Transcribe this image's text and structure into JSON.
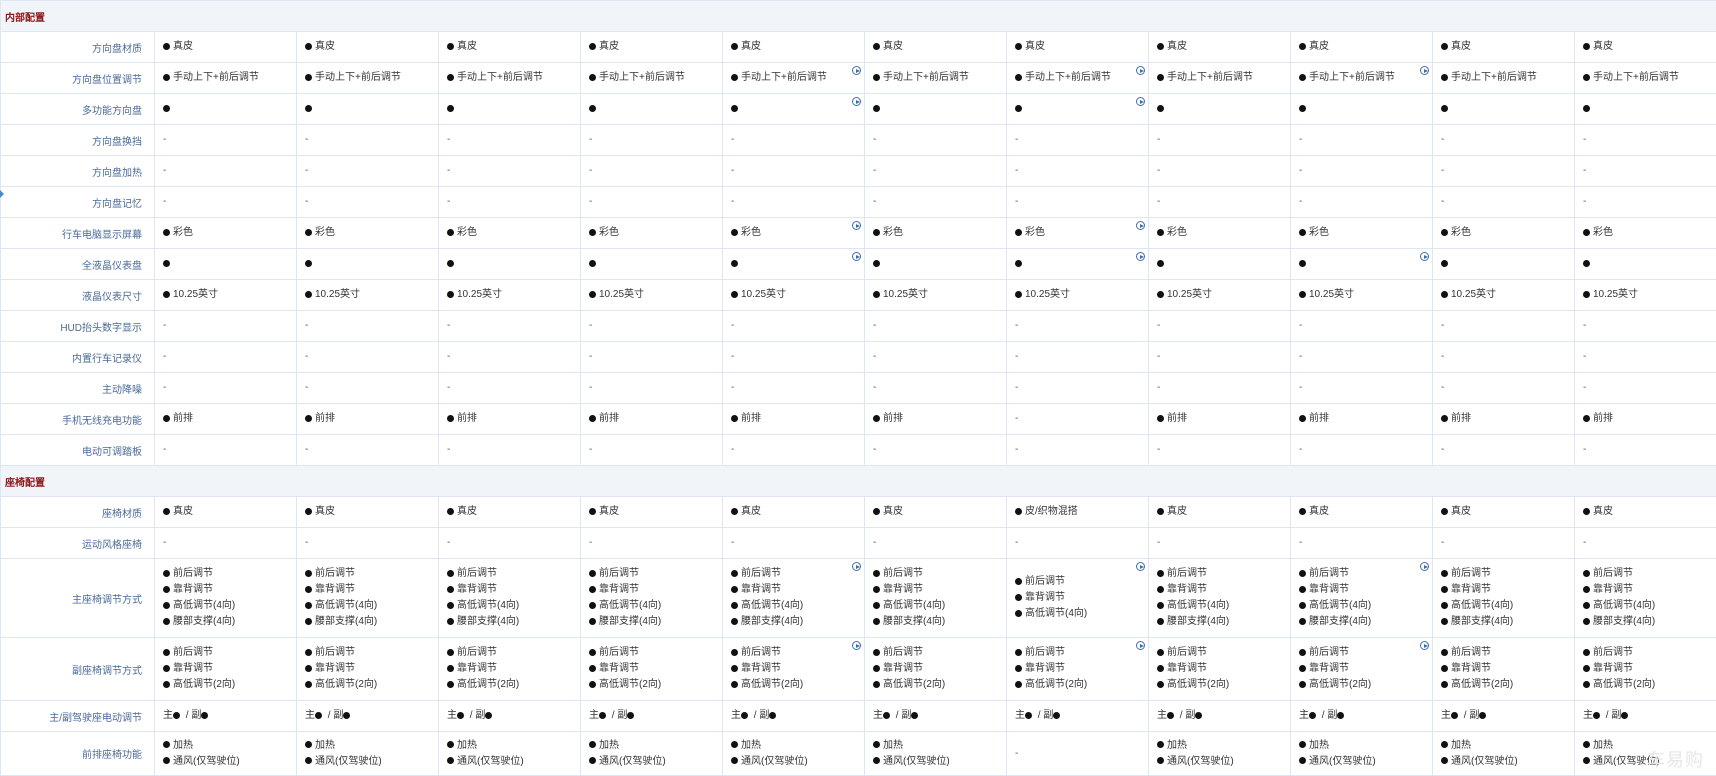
{
  "sections": [
    {
      "title": "内部配置",
      "rows": [
        {
          "label": "方向盘材质",
          "h": 31,
          "cells": [
            [
              "●真皮"
            ],
            [
              "●真皮"
            ],
            [
              "●真皮"
            ],
            [
              "●真皮"
            ],
            [
              "●真皮"
            ],
            [
              "●真皮"
            ],
            [
              "●真皮"
            ],
            [
              "●真皮"
            ],
            [
              "●真皮"
            ],
            [
              "●真皮"
            ],
            [
              "●真皮"
            ]
          ]
        },
        {
          "label": "方向盘位置调节",
          "h": 31,
          "play": [
            4,
            6,
            8
          ],
          "cells": [
            [
              "●手动上下+前后调节"
            ],
            [
              "●手动上下+前后调节"
            ],
            [
              "●手动上下+前后调节"
            ],
            [
              "●手动上下+前后调节"
            ],
            [
              "●手动上下+前后调节"
            ],
            [
              "●手动上下+前后调节"
            ],
            [
              "●手动上下+前后调节"
            ],
            [
              "●手动上下+前后调节"
            ],
            [
              "●手动上下+前后调节"
            ],
            [
              "●手动上下+前后调节"
            ],
            [
              "●手动上下+前后调节"
            ]
          ]
        },
        {
          "label": "多功能方向盘",
          "h": 31,
          "play": [
            4,
            6
          ],
          "cells": [
            [
              "●"
            ],
            [
              "●"
            ],
            [
              "●"
            ],
            [
              "●"
            ],
            [
              "●"
            ],
            [
              "●"
            ],
            [
              "●"
            ],
            [
              "●"
            ],
            [
              "●"
            ],
            [
              "●"
            ],
            [
              "●"
            ]
          ]
        },
        {
          "label": "方向盘换挡",
          "h": 31,
          "cells": [
            [
              "-"
            ],
            [
              "-"
            ],
            [
              "-"
            ],
            [
              "-"
            ],
            [
              "-"
            ],
            [
              "-"
            ],
            [
              "-"
            ],
            [
              "-"
            ],
            [
              "-"
            ],
            [
              "-"
            ],
            [
              "-"
            ]
          ]
        },
        {
          "label": "方向盘加热",
          "h": 31,
          "cells": [
            [
              "-"
            ],
            [
              "-"
            ],
            [
              "-"
            ],
            [
              "-"
            ],
            [
              "-"
            ],
            [
              "-"
            ],
            [
              "-"
            ],
            [
              "-"
            ],
            [
              "-"
            ],
            [
              "-"
            ],
            [
              "-"
            ]
          ]
        },
        {
          "label": "方向盘记忆",
          "h": 31,
          "cells": [
            [
              "-"
            ],
            [
              "-"
            ],
            [
              "-"
            ],
            [
              "-"
            ],
            [
              "-"
            ],
            [
              "-"
            ],
            [
              "-"
            ],
            [
              "-"
            ],
            [
              "-"
            ],
            [
              "-"
            ],
            [
              "-"
            ]
          ]
        },
        {
          "label": "行车电脑显示屏幕",
          "h": 31,
          "play": [
            4,
            6
          ],
          "cells": [
            [
              "●彩色"
            ],
            [
              "●彩色"
            ],
            [
              "●彩色"
            ],
            [
              "●彩色"
            ],
            [
              "●彩色"
            ],
            [
              "●彩色"
            ],
            [
              "●彩色"
            ],
            [
              "●彩色"
            ],
            [
              "●彩色"
            ],
            [
              "●彩色"
            ],
            [
              "●彩色"
            ]
          ]
        },
        {
          "label": "全液晶仪表盘",
          "h": 31,
          "play": [
            4,
            6,
            8
          ],
          "cells": [
            [
              "●"
            ],
            [
              "●"
            ],
            [
              "●"
            ],
            [
              "●"
            ],
            [
              "●"
            ],
            [
              "●"
            ],
            [
              "●"
            ],
            [
              "●"
            ],
            [
              "●"
            ],
            [
              "●"
            ],
            [
              "●"
            ]
          ]
        },
        {
          "label": "液晶仪表尺寸",
          "h": 31,
          "cells": [
            [
              "●10.25英寸"
            ],
            [
              "●10.25英寸"
            ],
            [
              "●10.25英寸"
            ],
            [
              "●10.25英寸"
            ],
            [
              "●10.25英寸"
            ],
            [
              "●10.25英寸"
            ],
            [
              "●10.25英寸"
            ],
            [
              "●10.25英寸"
            ],
            [
              "●10.25英寸"
            ],
            [
              "●10.25英寸"
            ],
            [
              "●10.25英寸"
            ]
          ]
        },
        {
          "label": "HUD抬头数字显示",
          "h": 31,
          "cells": [
            [
              "-"
            ],
            [
              "-"
            ],
            [
              "-"
            ],
            [
              "-"
            ],
            [
              "-"
            ],
            [
              "-"
            ],
            [
              "-"
            ],
            [
              "-"
            ],
            [
              "-"
            ],
            [
              "-"
            ],
            [
              "-"
            ]
          ]
        },
        {
          "label": "内置行车记录仪",
          "h": 31,
          "cells": [
            [
              "-"
            ],
            [
              "-"
            ],
            [
              "-"
            ],
            [
              "-"
            ],
            [
              "-"
            ],
            [
              "-"
            ],
            [
              "-"
            ],
            [
              "-"
            ],
            [
              "-"
            ],
            [
              "-"
            ],
            [
              "-"
            ]
          ]
        },
        {
          "label": "主动降噪",
          "h": 31,
          "cells": [
            [
              "-"
            ],
            [
              "-"
            ],
            [
              "-"
            ],
            [
              "-"
            ],
            [
              "-"
            ],
            [
              "-"
            ],
            [
              "-"
            ],
            [
              "-"
            ],
            [
              "-"
            ],
            [
              "-"
            ],
            [
              "-"
            ]
          ]
        },
        {
          "label": "手机无线充电功能",
          "h": 31,
          "cells": [
            [
              "●前排"
            ],
            [
              "●前排"
            ],
            [
              "●前排"
            ],
            [
              "●前排"
            ],
            [
              "●前排"
            ],
            [
              "●前排"
            ],
            [
              "-"
            ],
            [
              "●前排"
            ],
            [
              "●前排"
            ],
            [
              "●前排"
            ],
            [
              "●前排"
            ]
          ]
        },
        {
          "label": "电动可调踏板",
          "h": 31,
          "cells": [
            [
              "-"
            ],
            [
              "-"
            ],
            [
              "-"
            ],
            [
              "-"
            ],
            [
              "-"
            ],
            [
              "-"
            ],
            [
              "-"
            ],
            [
              "-"
            ],
            [
              "-"
            ],
            [
              "-"
            ],
            [
              "-"
            ]
          ]
        }
      ]
    },
    {
      "title": "座椅配置",
      "rows": [
        {
          "label": "座椅材质",
          "h": 31,
          "cells": [
            [
              "●真皮"
            ],
            [
              "●真皮"
            ],
            [
              "●真皮"
            ],
            [
              "●真皮"
            ],
            [
              "●真皮"
            ],
            [
              "●真皮"
            ],
            [
              "●皮/织物混搭"
            ],
            [
              "●真皮"
            ],
            [
              "●真皮"
            ],
            [
              "●真皮"
            ],
            [
              "●真皮"
            ]
          ]
        },
        {
          "label": "运动风格座椅",
          "h": 31,
          "cells": [
            [
              "-"
            ],
            [
              "-"
            ],
            [
              "-"
            ],
            [
              "-"
            ],
            [
              "-"
            ],
            [
              "-"
            ],
            [
              "-"
            ],
            [
              "-"
            ],
            [
              "-"
            ],
            [
              "-"
            ],
            [
              "-"
            ]
          ]
        },
        {
          "label": "主座椅调节方式",
          "h": 79,
          "play": [
            4,
            6,
            8
          ],
          "cells": [
            [
              "●前后调节",
              "●靠背调节",
              "●高低调节(4向)",
              "●腰部支撑(4向)"
            ],
            [
              "●前后调节",
              "●靠背调节",
              "●高低调节(4向)",
              "●腰部支撑(4向)"
            ],
            [
              "●前后调节",
              "●靠背调节",
              "●高低调节(4向)",
              "●腰部支撑(4向)"
            ],
            [
              "●前后调节",
              "●靠背调节",
              "●高低调节(4向)",
              "●腰部支撑(4向)"
            ],
            [
              "●前后调节",
              "●靠背调节",
              "●高低调节(4向)",
              "●腰部支撑(4向)"
            ],
            [
              "●前后调节",
              "●靠背调节",
              "●高低调节(4向)",
              "●腰部支撑(4向)"
            ],
            [
              "●前后调节",
              "●靠背调节",
              "●高低调节(4向)"
            ],
            [
              "●前后调节",
              "●靠背调节",
              "●高低调节(4向)",
              "●腰部支撑(4向)"
            ],
            [
              "●前后调节",
              "●靠背调节",
              "●高低调节(4向)",
              "●腰部支撑(4向)"
            ],
            [
              "●前后调节",
              "●靠背调节",
              "●高低调节(4向)",
              "●腰部支撑(4向)"
            ],
            [
              "●前后调节",
              "●靠背调节",
              "●高低调节(4向)",
              "●腰部支撑(4向)"
            ]
          ]
        },
        {
          "label": "副座椅调节方式",
          "h": 63,
          "play": [
            4,
            6,
            8
          ],
          "cells": [
            [
              "●前后调节",
              "●靠背调节",
              "●高低调节(2向)"
            ],
            [
              "●前后调节",
              "●靠背调节",
              "●高低调节(2向)"
            ],
            [
              "●前后调节",
              "●靠背调节",
              "●高低调节(2向)"
            ],
            [
              "●前后调节",
              "●靠背调节",
              "●高低调节(2向)"
            ],
            [
              "●前后调节",
              "●靠背调节",
              "●高低调节(2向)"
            ],
            [
              "●前后调节",
              "●靠背调节",
              "●高低调节(2向)"
            ],
            [
              "●前后调节",
              "●靠背调节",
              "●高低调节(2向)"
            ],
            [
              "●前后调节",
              "●靠背调节",
              "●高低调节(2向)"
            ],
            [
              "●前后调节",
              "●靠背调节",
              "●高低调节(2向)"
            ],
            [
              "●前后调节",
              "●靠背调节",
              "●高低调节(2向)"
            ],
            [
              "●前后调节",
              "●靠背调节",
              "●高低调节(2向)"
            ]
          ]
        },
        {
          "label": "主/副驾驶座电动调节",
          "h": 31,
          "cells": [
            [
              "主● / 副●"
            ],
            [
              "主● / 副●"
            ],
            [
              "主● / 副●"
            ],
            [
              "主● / 副●"
            ],
            [
              "主● / 副●"
            ],
            [
              "主● / 副●"
            ],
            [
              "主● / 副●"
            ],
            [
              "主● / 副●"
            ],
            [
              "主● / 副●"
            ],
            [
              "主● / 副●"
            ],
            [
              "主● / 副●"
            ]
          ]
        },
        {
          "label": "前排座椅功能",
          "h": 44,
          "cells": [
            [
              "●加热",
              "●通风(仅驾驶位)"
            ],
            [
              "●加热",
              "●通风(仅驾驶位)"
            ],
            [
              "●加热",
              "●通风(仅驾驶位)"
            ],
            [
              "●加热",
              "●通风(仅驾驶位)"
            ],
            [
              "●加热",
              "●通风(仅驾驶位)"
            ],
            [
              "●加热",
              "●通风(仅驾驶位)"
            ],
            [
              "-"
            ],
            [
              "●加热",
              "●通风(仅驾驶位)"
            ],
            [
              "●加热",
              "●通风(仅驾驶位)"
            ],
            [
              "●加热",
              "●通风(仅驾驶位)"
            ],
            [
              "●加热",
              "●通风(仅驾驶位)"
            ]
          ]
        }
      ]
    }
  ],
  "watermark": "车易购"
}
